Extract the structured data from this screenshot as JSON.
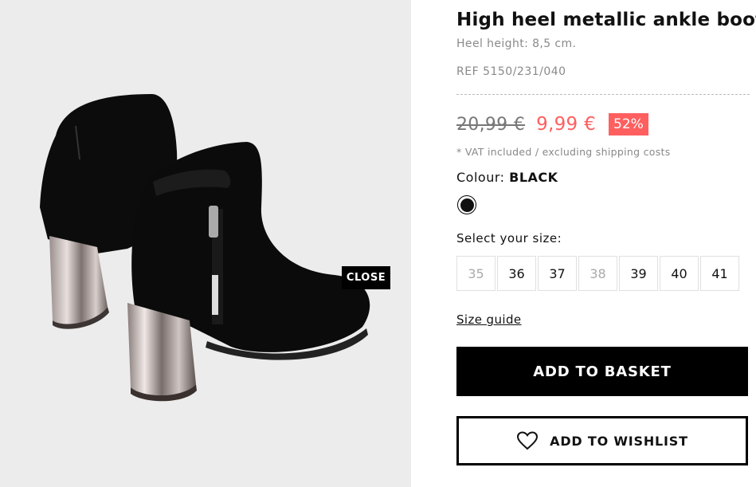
{
  "product": {
    "title": "High heel metallic ankle boots",
    "heel_height": "Heel height: 8,5 cm.",
    "ref": "REF 5150/231/040",
    "old_price": "20,99 €",
    "new_price": "9,99 €",
    "discount": "52%",
    "vat_note": "* VAT included / excluding shipping costs"
  },
  "colour": {
    "label": "Colour:",
    "value": "BLACK",
    "swatch_color": "#111111"
  },
  "sizes": {
    "label": "Select your size:",
    "options": [
      {
        "size": "35",
        "available": false
      },
      {
        "size": "36",
        "available": true
      },
      {
        "size": "37",
        "available": true
      },
      {
        "size": "38",
        "available": false
      },
      {
        "size": "39",
        "available": true
      },
      {
        "size": "40",
        "available": true
      },
      {
        "size": "41",
        "available": true
      }
    ]
  },
  "actions": {
    "size_guide": "Size guide",
    "add_to_basket": "ADD TO BASKET",
    "add_to_wishlist": "ADD TO WISHLIST",
    "close": "CLOSE"
  },
  "colors": {
    "sale_red": "#ff5f5f",
    "image_bg": "#ececec"
  }
}
